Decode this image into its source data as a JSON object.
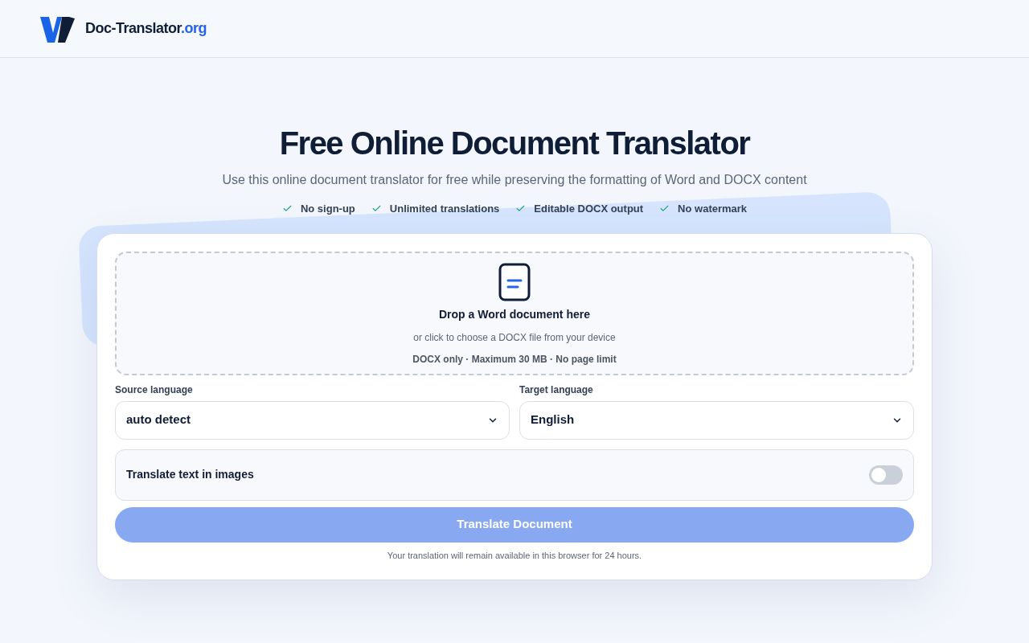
{
  "header": {
    "brand": "Doc-Translator",
    "brand_suffix": ".org"
  },
  "hero": {
    "title": "Free Online Document Translator",
    "subtitle": "Use this online document translator for free while preserving the formatting of Word and DOCX content",
    "features": [
      "No sign-up",
      "Unlimited translations",
      "Editable DOCX output",
      "No watermark"
    ]
  },
  "dropzone": {
    "title": "Drop a Word document here",
    "hint": "or click to choose a DOCX file from your device",
    "limits": "DOCX only · Maximum 30 MB · No page limit"
  },
  "languages": [
    {
      "label": "Source language",
      "value": "auto detect"
    },
    {
      "label": "Target language",
      "value": "English"
    }
  ],
  "image_option": {
    "label": "Translate text in images",
    "on": false
  },
  "translate_button": {
    "label": "Translate Document",
    "disabled": true
  },
  "note": "Your translation will remain available in this browser for 24 hours."
}
